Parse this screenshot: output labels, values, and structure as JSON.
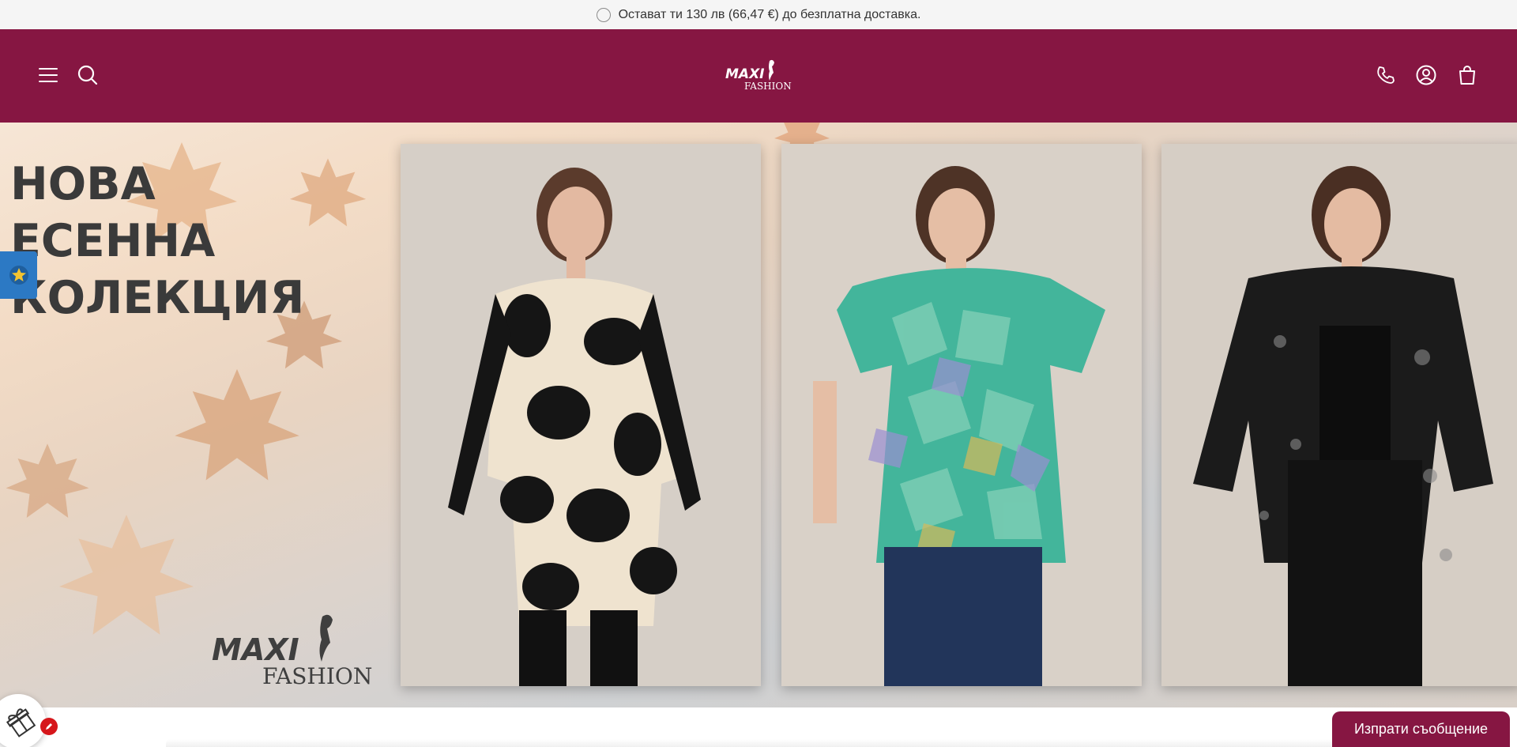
{
  "announcement": {
    "text": "Остават ти 130 лв (66,47 €) до безплатна доставка."
  },
  "header": {
    "icons": [
      "menu-icon",
      "search-icon",
      "phone-icon",
      "account-icon",
      "cart-icon"
    ],
    "logo": {
      "line1": "MAXI",
      "line2": "FASHION"
    },
    "background": "#861642"
  },
  "hero": {
    "title_lines": [
      "НОВА",
      "ЕСЕННА",
      "КОЛЕКЦИЯ"
    ],
    "watermark_logo": {
      "line1": "MAXI",
      "line2": "FASHION"
    }
  },
  "widgets": {
    "message_button": "Изпрати съобщение",
    "review_tab_icon": "star-icon",
    "gift_icon": "gift-icon"
  },
  "colors": {
    "brand": "#861642",
    "review_tab": "#2c79c4",
    "badge": "#d6161b"
  }
}
